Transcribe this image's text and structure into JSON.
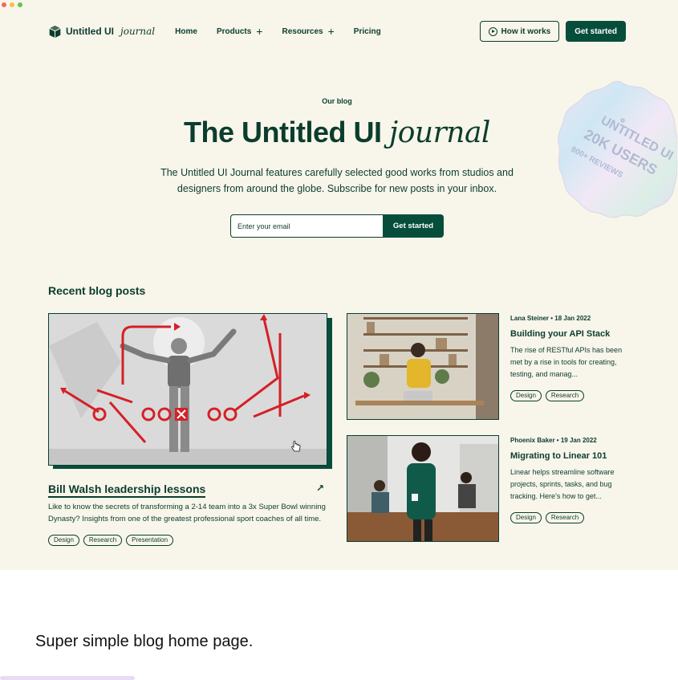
{
  "window": {
    "dots": [
      "#ed6a5e",
      "#f5bf4f",
      "#61c554"
    ]
  },
  "nav": {
    "logo_text": "Untitled UI",
    "logo_italic": "journal",
    "links": [
      {
        "label": "Home",
        "has_plus": false
      },
      {
        "label": "Products",
        "has_plus": true
      },
      {
        "label": "Resources",
        "has_plus": true
      },
      {
        "label": "Pricing",
        "has_plus": false
      }
    ],
    "plus_glyph": "+",
    "how_it_works": "How it works",
    "get_started": "Get started"
  },
  "hero": {
    "eyebrow": "Our blog",
    "title_main": "The Untitled UI",
    "title_italic": "journal",
    "subtitle": "The Untitled UI Journal features carefully selected good works from studios and designers from around the globe. Subscribe for new posts in your inbox.",
    "email_placeholder": "Enter your email",
    "subscribe_button": "Get started"
  },
  "badge": {
    "line1": "UNTITLED UI",
    "line2": "20K USERS",
    "line3": "800+ REVIEWS"
  },
  "blog": {
    "section_title": "Recent blog posts",
    "featured": {
      "title": "Bill Walsh leadership lessons",
      "arrow": "↗",
      "description": "Like to know the secrets of transforming a 2-14 team into a 3x Super Bowl winning Dynasty? Insights from one of the greatest professional sport coaches of all time.",
      "tags": [
        "Design",
        "Research",
        "Presentation"
      ]
    },
    "posts": [
      {
        "meta": "Lana Steiner • 18 Jan 2022",
        "title": "Building your API Stack",
        "description": "The rise of RESTful APIs has been met by a rise in tools for creating, testing, and manag...",
        "tags": [
          "Design",
          "Research"
        ]
      },
      {
        "meta": "Phoenix Baker • 19 Jan 2022",
        "title": "Migrating to Linear 101",
        "description": "Linear helps streamline software projects, sprints, tasks, and bug tracking. Here’s how to get...",
        "tags": [
          "Design",
          "Research"
        ]
      }
    ]
  },
  "caption": "Super simple blog home page.",
  "colors": {
    "brand": "#064e3b",
    "text": "#0b3d2e",
    "page_bg": "#f8f5ea",
    "accent_red": "#d42027"
  }
}
